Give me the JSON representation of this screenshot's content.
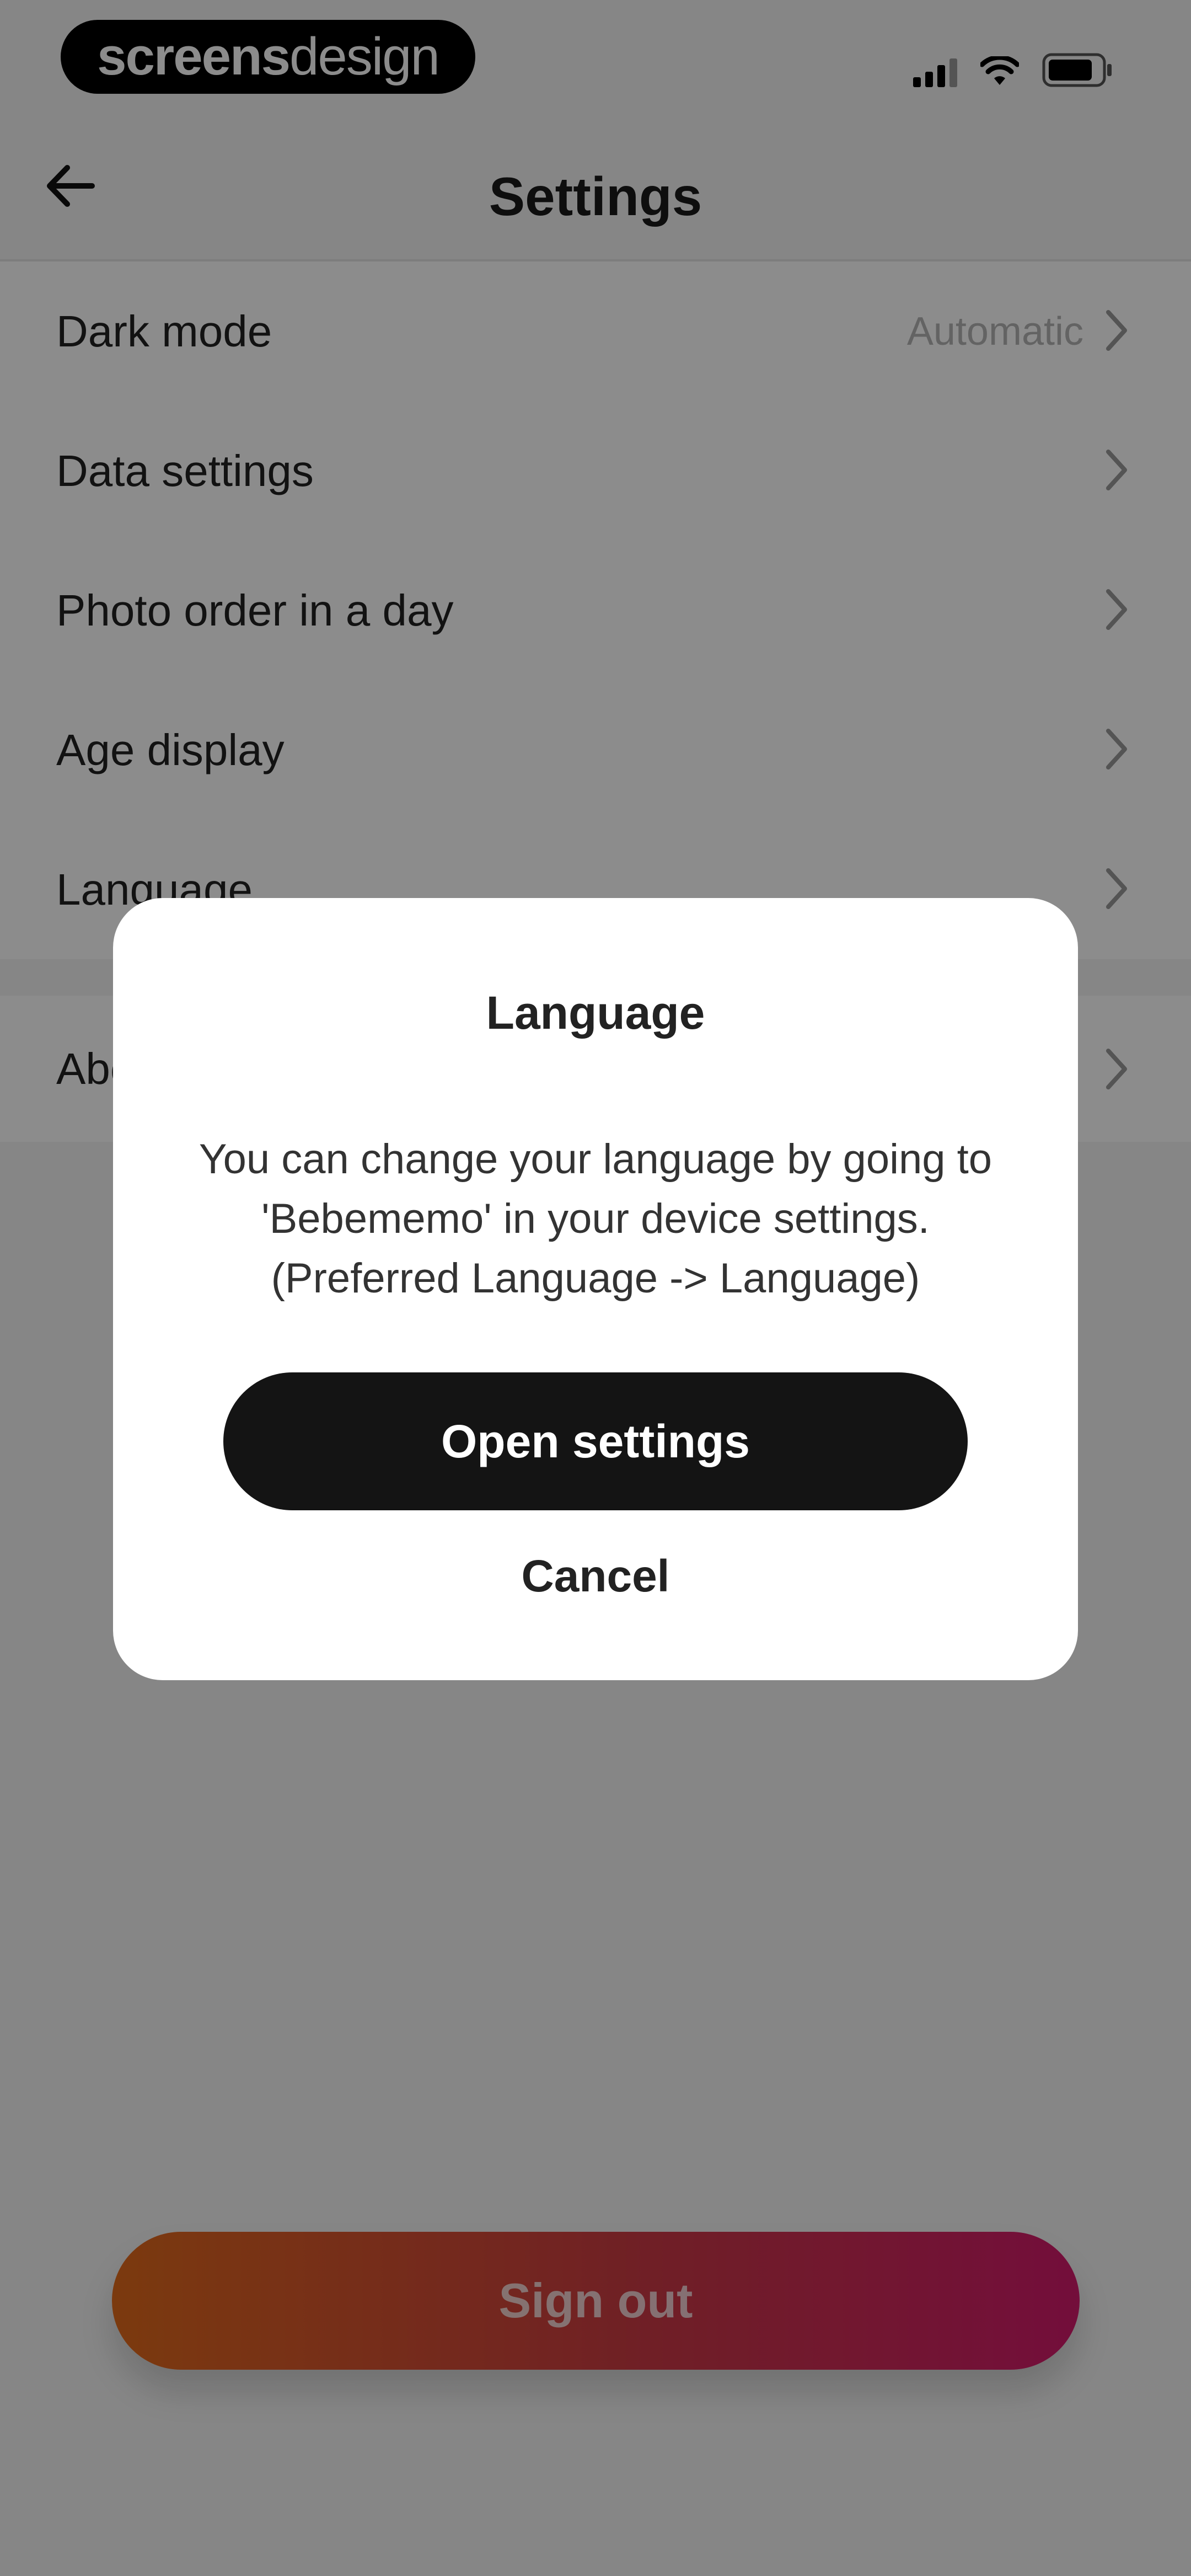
{
  "status_bar": {
    "brand_part1": "screens",
    "brand_part2": "design"
  },
  "header": {
    "title": "Settings"
  },
  "settings": {
    "items": [
      {
        "label": "Dark mode",
        "value": "Automatic"
      },
      {
        "label": "Data settings",
        "value": ""
      },
      {
        "label": "Photo order in a day",
        "value": ""
      },
      {
        "label": "Age display",
        "value": ""
      },
      {
        "label": "Language",
        "value": ""
      }
    ],
    "about_label": "About"
  },
  "dialog": {
    "title": "Language",
    "message_line1": "You can change your language by going to",
    "message_line2": "'Bebememo' in your device settings.",
    "message_line3": "(Preferred Language -> Language)",
    "primary_button": "Open settings",
    "cancel_button": "Cancel"
  },
  "footer": {
    "sign_out_label": "Sign out"
  },
  "colors": {
    "sign_out_gradient": [
      "#e16a1b",
      "#cc3a45",
      "#d21a6c"
    ],
    "primary_button": "#141414",
    "overlay": "rgba(0,0,0,0.45)"
  }
}
